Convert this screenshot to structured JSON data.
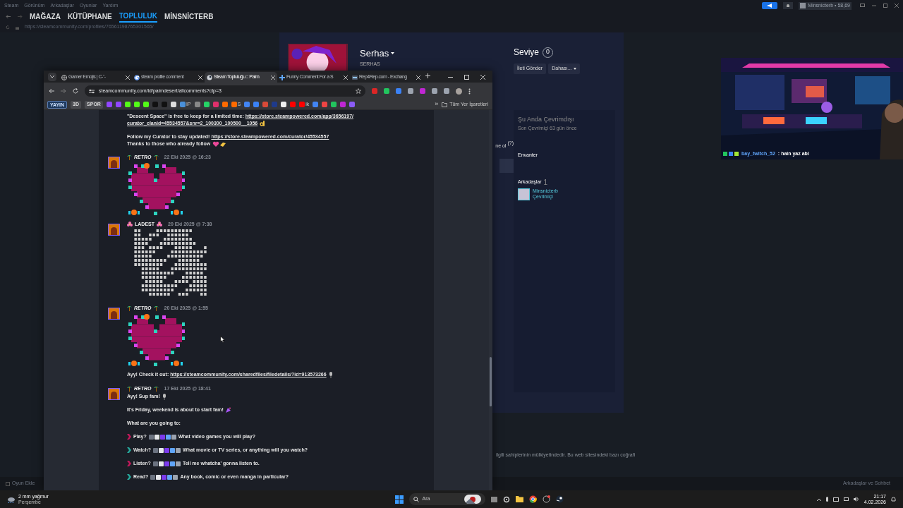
{
  "steam": {
    "menu": [
      "Steam",
      "Görünüm",
      "Arkadaşlar",
      "Oyunlar",
      "Yardım"
    ],
    "nav": [
      {
        "label": "MAĞAZA",
        "selected": false
      },
      {
        "label": "KÜTÜPHANE",
        "selected": false
      },
      {
        "label": "TOPLULUK",
        "selected": true
      },
      {
        "label": "MİNSNİCTERB",
        "selected": false
      }
    ],
    "url": "https://steamcommunity.com/profiles/76561198765301565/",
    "account": "Minsnicterb • 58,69",
    "profile": {
      "name": "Serhas",
      "alias": "SERHAS",
      "level_label": "Seviye",
      "level_value": "0",
      "buttons": [
        "İleti Gönder",
        "Dahası..."
      ],
      "fragment": "ne ol",
      "fragment_hint": "(?)",
      "status": "Şu Anda Çevrimdışı",
      "last_online": "Son Çevrimiçi 63 gün önce",
      "inventory": "Envanter",
      "friends_label": "Arkadaşlar",
      "friends_count": "1",
      "friend": {
        "name": "Minsnicterb",
        "status": "Çevrimiçi"
      }
    },
    "footer": "ilgili sahiplerinin mülkiyetindedir. Bu web sitesindeki bazı coğrafi",
    "bottom_bar": {
      "left": "Oyun Ekle",
      "right": "Arkadaşlar ve Sohbet"
    }
  },
  "webcam": {
    "user": "bay_twitch_52",
    "message": ": hain yaz abi"
  },
  "browser": {
    "tabs": [
      {
        "title": "Gamer Emojis | C-ˆ-",
        "selected": false
      },
      {
        "title": "steam profile comment",
        "selected": false
      },
      {
        "title": "Steam Topluluğu :: Palm",
        "selected": true
      },
      {
        "title": "Funny Comment For a S",
        "selected": false
      },
      {
        "title": "Rep4Rep.com - Exchang",
        "selected": false
      }
    ],
    "url": "steamcommunity.com/id/palmdesert/allcomments?ctp=3",
    "bookmarks": [
      {
        "kind": "text",
        "label": "YAYIN"
      },
      {
        "kind": "text",
        "label": "3D"
      },
      {
        "kind": "text",
        "label": "SPOR"
      },
      {
        "kind": "icon",
        "color": "#9146ff"
      },
      {
        "kind": "icon",
        "color": "#9146ff"
      },
      {
        "kind": "icon",
        "color": "#53fc18"
      },
      {
        "kind": "icon",
        "color": "#53fc18"
      },
      {
        "kind": "icon",
        "color": "#53fc18"
      },
      {
        "kind": "icon",
        "color": "#111111"
      },
      {
        "kind": "icon",
        "color": "#111111"
      },
      {
        "kind": "icon",
        "color": "#dddddd"
      },
      {
        "kind": "icon",
        "color": "#4a90d9",
        "label": "IP"
      },
      {
        "kind": "icon",
        "color": "#888888"
      },
      {
        "kind": "icon",
        "color": "#25d366"
      },
      {
        "kind": "icon",
        "color": "#e1306c"
      },
      {
        "kind": "icon",
        "color": "#ff6a00"
      },
      {
        "kind": "icon",
        "color": "#ff6a00",
        "label": "S"
      },
      {
        "kind": "icon",
        "color": "#4285f4"
      },
      {
        "kind": "icon",
        "color": "#3b82f6"
      },
      {
        "kind": "icon",
        "color": "#d84a38"
      },
      {
        "kind": "icon",
        "color": "#1e3a8a"
      },
      {
        "kind": "icon",
        "color": "#eeeeee"
      },
      {
        "kind": "icon",
        "color": "#ff0000"
      },
      {
        "kind": "icon",
        "color": "#ff0000",
        "label": "ik"
      },
      {
        "kind": "icon",
        "color": "#4285f4"
      },
      {
        "kind": "icon",
        "color": "#ef4444"
      },
      {
        "kind": "icon",
        "color": "#22c55e"
      },
      {
        "kind": "icon",
        "color": "#c026d3"
      },
      {
        "kind": "icon",
        "color": "#8b5cf6"
      }
    ],
    "bookmarks_more": "»",
    "bookmarks_folder": "Tüm Yer İşaretleri",
    "comments": [
      {
        "kind": "tail",
        "blocks": [
          {
            "kind": "paragraph",
            "lines": [
              {
                "kind": "plain",
                "text": "\"Descent Space\" is free to keep for a limited time:",
                "link": "https://store.steampowered.com/app/3656197/"
              },
              {
                "kind": "ok",
                "link": "curator_clanid=45534557&snr=2_100300_100500__1056"
              }
            ]
          },
          {
            "kind": "paragraph",
            "lines": [
              {
                "kind": "plain",
                "text": "Follow my Curator to stay updated!",
                "link": "https://store.steampowered.com/curator/45534557"
              },
              {
                "kind": "heart",
                "text": "Thanks to those who already follow"
              }
            ]
          }
        ]
      },
      {
        "kind": "palm",
        "author": "RETRO",
        "italic": true,
        "date": "22 Eki 2025 @ 16:23",
        "blocks": [
          {
            "kind": "heart_art"
          }
        ]
      },
      {
        "kind": "flower",
        "author": "LADEST",
        "italic": false,
        "date": "20 Eki 2025 @ 7:38",
        "blocks": [
          {
            "kind": "ascii_art"
          }
        ]
      },
      {
        "kind": "palm",
        "author": "RETRO",
        "italic": true,
        "date": "20 Eki 2025 @ 1:55",
        "blocks": [
          {
            "kind": "heart_art"
          },
          {
            "kind": "paragraph",
            "lines": [
              {
                "kind": "mic",
                "text": "Ayy! Check it out:",
                "link": "https://steamcommunity.com/sharedfiles/filedetails/?id=913573266"
              }
            ]
          }
        ]
      },
      {
        "kind": "palm",
        "author": "RETRO",
        "italic": true,
        "date": "17 Eki 2025 @ 18:41",
        "blocks": [
          {
            "kind": "paragraph",
            "lines": [
              {
                "kind": "mic",
                "text": "Ayy! Sup fam!"
              }
            ]
          },
          {
            "kind": "paragraph",
            "lines": [
              {
                "kind": "party",
                "text": "It's Friday, weekend is about to start fam!"
              }
            ]
          },
          {
            "kind": "paragraph",
            "lines": [
              {
                "kind": "plain",
                "text": "What are you going to:"
              }
            ]
          },
          {
            "kind": "bullet",
            "color": "#c2185b",
            "label": "Play?",
            "text": "What video games you will play?"
          },
          {
            "kind": "bullet",
            "color": "#26a69a",
            "label": "Watch?",
            "text": "What movie or TV series, or anything will you watch?"
          },
          {
            "kind": "bullet",
            "color": "#c2185b",
            "label": "Listen?",
            "text": "Tell me whatcha' gonna listen to."
          },
          {
            "kind": "bullet",
            "color": "#26a69a",
            "label": "Read?",
            "text": "Any book, comic or even manga in particular?"
          }
        ]
      }
    ]
  },
  "taskbar": {
    "weather": "2 mm yağmur",
    "day": "Perşembe",
    "search": "Ara",
    "time": "21:17",
    "date": "4.02.2026"
  }
}
